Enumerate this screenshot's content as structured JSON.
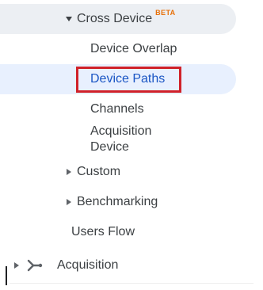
{
  "nav": {
    "cross_device": {
      "label": "Cross Device",
      "badge": "BETA"
    },
    "device_overlap": {
      "label": "Device Overlap"
    },
    "device_paths": {
      "label": "Device Paths"
    },
    "channels": {
      "label": "Channels"
    },
    "acquisition_device": {
      "line1": "Acquisition",
      "line2": "Device"
    },
    "custom": {
      "label": "Custom"
    },
    "benchmarking": {
      "label": "Benchmarking"
    },
    "users_flow": {
      "label": "Users Flow"
    },
    "acquisition": {
      "label": "Acquisition"
    }
  },
  "icons": {
    "expanded_caret": "caret-down-icon",
    "collapsed_caret": "caret-right-icon",
    "acquisition": "branch-icon"
  },
  "colors": {
    "active_text": "#1a55c4",
    "active_bg": "#e8f0fe",
    "parent_bg": "#eceff3",
    "highlight_border": "#d0212a",
    "beta_badge": "#e8710a"
  }
}
